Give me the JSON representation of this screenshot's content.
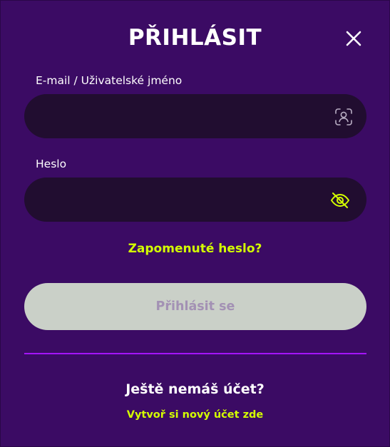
{
  "title": "PŘIHLÁSIT",
  "close_icon": "close-icon",
  "email": {
    "label": "E-mail / Uživatelské jméno",
    "value": "",
    "placeholder": "",
    "icon": "user-scan-icon",
    "icon_color": "#b9aec4"
  },
  "password": {
    "label": "Heslo",
    "value": "",
    "placeholder": "",
    "icon": "eye-off-icon",
    "icon_color": "#d4ff00"
  },
  "forgot_password": "Zapomenuté heslo?",
  "submit_label": "Přihlásit se",
  "no_account_text": "Ještě nemáš účet?",
  "create_account_link": "Vytvoř si nový účet zde",
  "colors": {
    "background": "#3b0b64",
    "input_background": "#210d30",
    "accent": "#d4ff00",
    "divider": "#a414ff",
    "button_disabled": "#cad0c8",
    "button_text": "#a391b4"
  }
}
